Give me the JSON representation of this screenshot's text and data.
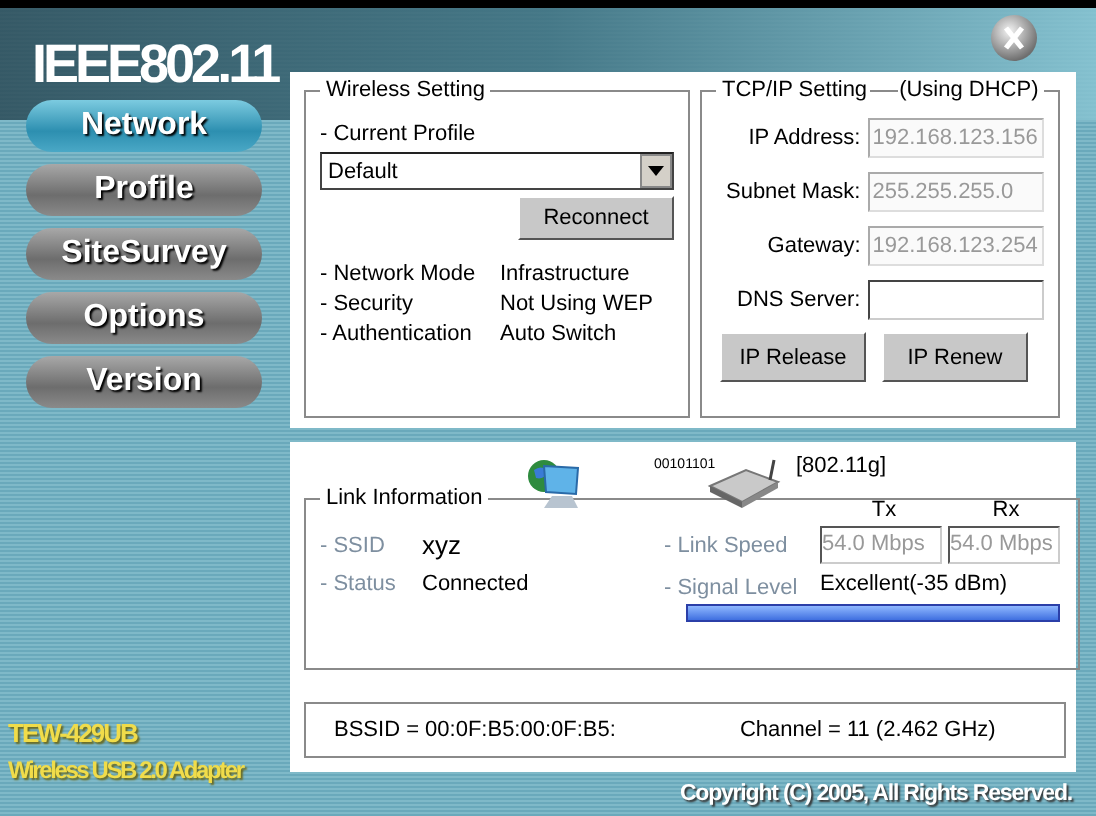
{
  "logo": "IEEE802.11",
  "nav": [
    {
      "label": "Network",
      "selected": true
    },
    {
      "label": "Profile",
      "selected": false
    },
    {
      "label": "SiteSurvey",
      "selected": false
    },
    {
      "label": "Options",
      "selected": false
    },
    {
      "label": "Version",
      "selected": false
    }
  ],
  "product": {
    "model": "TEW-429UB",
    "description": "Wireless USB 2.0 Adapter"
  },
  "wireless_setting": {
    "title": "Wireless Setting",
    "current_profile_label": "- Current Profile",
    "profile": "Default",
    "reconnect_button": "Reconnect",
    "rows": [
      {
        "label": "- Network Mode",
        "value": "Infrastructure"
      },
      {
        "label": "- Security",
        "value": "Not Using WEP"
      },
      {
        "label": "- Authentication",
        "value": "Auto Switch"
      }
    ]
  },
  "tcpip": {
    "title": "TCP/IP Setting",
    "mode": "(Using DHCP)",
    "fields": [
      {
        "label": "IP Address:",
        "value": "192.168.123.156",
        "disabled": true
      },
      {
        "label": "Subnet Mask:",
        "value": "255.255.255.0",
        "disabled": true
      },
      {
        "label": "Gateway:",
        "value": "192.168.123.254",
        "disabled": true
      },
      {
        "label": "DNS Server:",
        "disabled": false
      }
    ],
    "buttons": [
      "IP Release",
      "IP Renew"
    ]
  },
  "link": {
    "title": "Link Information",
    "binary": "00101101",
    "standard": "[802.11g]",
    "tx_label": "Tx",
    "rx_label": "Rx",
    "ssid_label": "- SSID",
    "ssid": "xyz",
    "status_label": "- Status",
    "status": "Connected",
    "speed_label": "- Link Speed",
    "tx": "54.0 Mbps",
    "rx": "54.0 Mbps",
    "signal_label": "- Signal Level",
    "signal": "Excellent(-35 dBm)",
    "level": 1.0
  },
  "bssid": "BSSID = 00:0F:B5:00:0F:B5:",
  "channel": "Channel = 11 (2.462 GHz)",
  "copyright": "Copyright (C) 2005, All Rights Reserved."
}
